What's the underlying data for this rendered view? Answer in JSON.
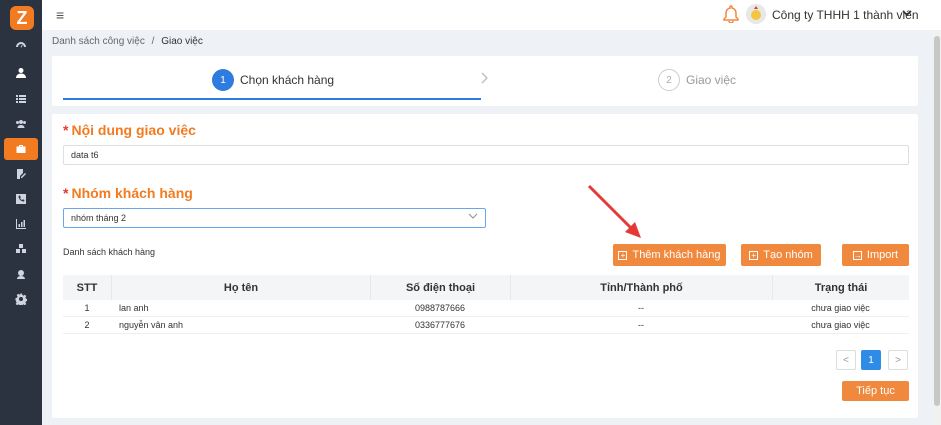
{
  "app": {
    "logo_letter": "Z",
    "company": "Công ty THHH 1 thành viên"
  },
  "breadcrumb": {
    "parent": "Danh sách công việc",
    "separator": "/",
    "current": "Giao việc"
  },
  "steps": [
    {
      "number": "1",
      "label": "Chọn khách hàng",
      "active": true
    },
    {
      "number": "2",
      "label": "Giao việc",
      "active": false
    }
  ],
  "form": {
    "content_label": "Nội dung giao việc",
    "content_value": "data t6",
    "group_label": "Nhóm khách hàng",
    "group_value": "nhóm tháng 2",
    "required_mark": "*"
  },
  "customers": {
    "list_label": "Danh sách khách hàng",
    "add_button": "Thêm khách hàng",
    "create_group_button": "Tạo nhóm",
    "import_button": "Import",
    "columns": [
      "STT",
      "Họ tên",
      "Số điện thoại",
      "Tỉnh/Thành phố",
      "Trạng thái"
    ],
    "rows": [
      {
        "stt": "1",
        "name": "lan anh",
        "phone": "0988787666",
        "city": "--",
        "status": "chưa giao việc"
      },
      {
        "stt": "2",
        "name": "nguyễn vân anh",
        "phone": "0336777676",
        "city": "--",
        "status": "chưa giao việc"
      }
    ]
  },
  "pagination": {
    "prev": "<",
    "current": "1",
    "next": ">"
  },
  "continue_button": "Tiếp tục",
  "colors": {
    "accent": "#f27b21",
    "primary": "#2e7ce0",
    "sidebar": "#2b3240"
  }
}
